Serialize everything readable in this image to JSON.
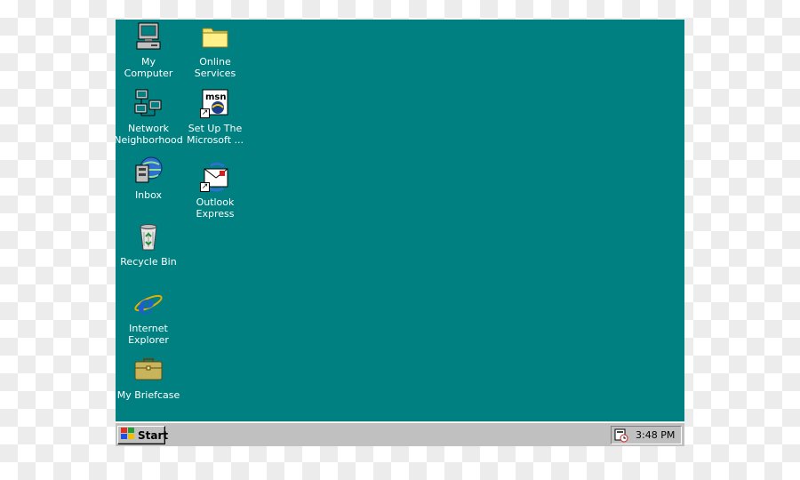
{
  "desktop": {
    "background_color": "#008080",
    "icons": [
      {
        "name": "my-computer-icon",
        "label": "My Computer"
      },
      {
        "name": "online-services-icon",
        "label": "Online\nServices"
      },
      {
        "name": "network-neighborhood-icon",
        "label": "Network\nNeighborhood"
      },
      {
        "name": "msn-setup-icon",
        "label": "Set Up The\nMicrosoft ..."
      },
      {
        "name": "inbox-icon",
        "label": "Inbox"
      },
      {
        "name": "outlook-express-icon",
        "label": "Outlook\nExpress"
      },
      {
        "name": "recycle-bin-icon",
        "label": "Recycle Bin"
      },
      {
        "name": "internet-explorer-icon",
        "label": "Internet\nExplorer"
      },
      {
        "name": "my-briefcase-icon",
        "label": "My Briefcase"
      }
    ]
  },
  "taskbar": {
    "start_label": "Start",
    "clock": "3:48 PM",
    "tray_icon": "scheduler-icon"
  }
}
